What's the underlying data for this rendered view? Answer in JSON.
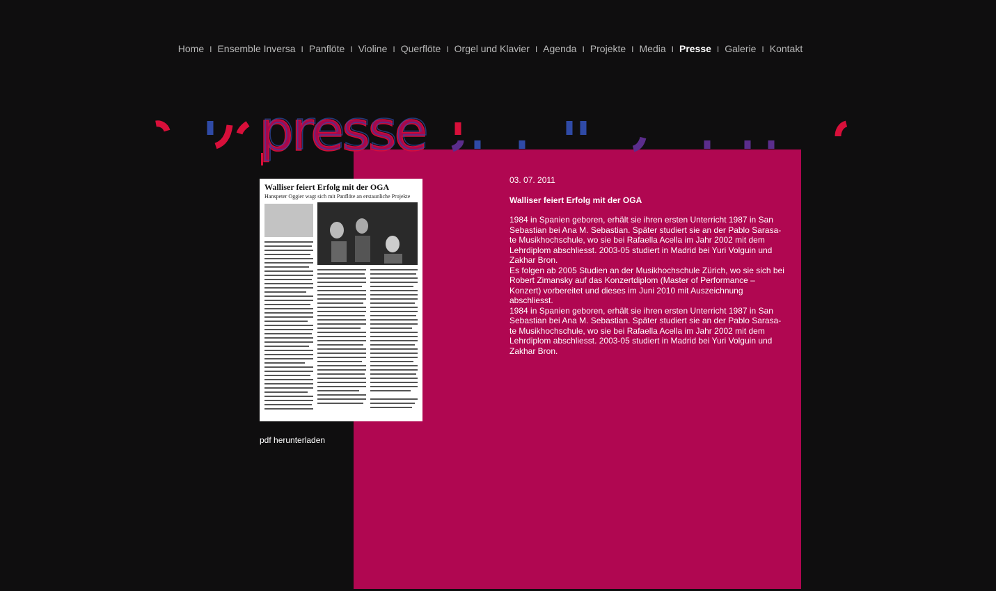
{
  "nav": {
    "items": [
      {
        "label": "Home",
        "slug": "home"
      },
      {
        "label": "Ensemble Inversa",
        "slug": "ensemble-inversa"
      },
      {
        "label": "Panflöte",
        "slug": "panfloete"
      },
      {
        "label": "Violine",
        "slug": "violine"
      },
      {
        "label": "Querflöte",
        "slug": "querfloete"
      },
      {
        "label": "Orgel und Klavier",
        "slug": "orgel-und-klavier"
      },
      {
        "label": "Agenda",
        "slug": "agenda"
      },
      {
        "label": "Projekte",
        "slug": "projekte"
      },
      {
        "label": "Media",
        "slug": "media"
      },
      {
        "label": "Presse",
        "slug": "presse",
        "active": true
      },
      {
        "label": "Galerie",
        "slug": "galerie"
      },
      {
        "label": "Kontakt",
        "slug": "kontakt"
      }
    ],
    "separator": "I"
  },
  "banner": {
    "title": "presse"
  },
  "colors": {
    "panel": "#b00751",
    "background": "#0f0e0f",
    "banner_red": "#d80f3a",
    "banner_blue": "#2f4aa6",
    "banner_purple": "#5b2d8c"
  },
  "clipping": {
    "headline": "Walliser feiert Erfolg mit der OGA",
    "subheadline": "Hanspeter Oggier wagt sich mit Panflöte an erstaunliche Projekte"
  },
  "pdf_link": "pdf herunterladen",
  "article": {
    "date": "03. 07. 2011",
    "title": "Walliser feiert Erfolg mit der OGA",
    "paragraphs": [
      "1984 in Spanien geboren, erhält sie ihren ersten Unterricht 1987 in San Sebastian bei Ana M. Sebastian. Später studiert sie an der Pablo Sarasa-te Musikhochschule, wo sie bei Rafaella Acella im Jahr 2002 mit dem Lehrdiplom abschliesst. 2003-05 studiert in Madrid bei Yuri Volguin und Zakhar Bron.",
      "Es folgen ab 2005 Studien an der Musikhochschule Zürich, wo sie sich bei Robert Zimansky auf das Konzertdiplom (Master of Performance – Konzert) vorbereitet und dieses im Juni 2010 mit Auszeichnung abschliesst.",
      "1984 in Spanien geboren, erhält sie ihren ersten Unterricht 1987 in San Sebastian bei Ana M. Sebastian. Später studiert sie an der Pablo Sarasa-te Musikhochschule, wo sie bei Rafaella Acella im Jahr 2002 mit dem Lehrdiplom abschliesst. 2003-05 studiert in Madrid bei Yuri Volguin und Zakhar Bron."
    ]
  }
}
